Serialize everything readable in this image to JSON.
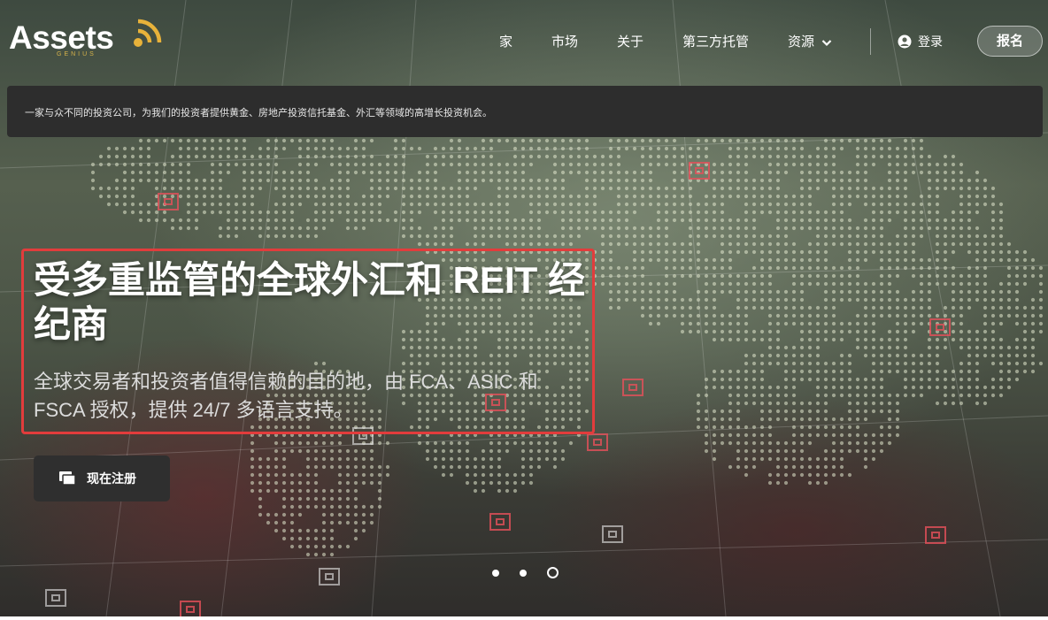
{
  "brand": {
    "logo_text": "Assets",
    "logo_sub": "GENIUS",
    "accent_color": "#e8b23a"
  },
  "nav": {
    "items": [
      {
        "label": "家"
      },
      {
        "label": "市场"
      },
      {
        "label": "关于"
      },
      {
        "label": "第三方托管"
      },
      {
        "label": "资源",
        "has_dropdown": true
      }
    ],
    "login_label": "登录",
    "signup_label": "报名"
  },
  "banner": {
    "text": "一家与众不同的投资公司，为我们的投资者提供黄金、房地产投资信托基金、外汇等领域的高增长投资机会。"
  },
  "hero": {
    "headline": "受多重监管的全球外汇和 REIT 经纪商",
    "subline": "全球交易者和投资者值得信赖的目的地，由 FCA、ASIC 和 FSCA 授权，提供 24/7 多语言支持。",
    "highlight_color": "#e23c3c",
    "cta_label": "现在注册"
  },
  "carousel": {
    "slide_count": 3,
    "active_index": 2
  },
  "icons": {
    "logo": "wifi-signal-icon",
    "dropdown": "chevron-down-icon",
    "login": "user-circle-icon",
    "cta": "document-stack-icon"
  }
}
